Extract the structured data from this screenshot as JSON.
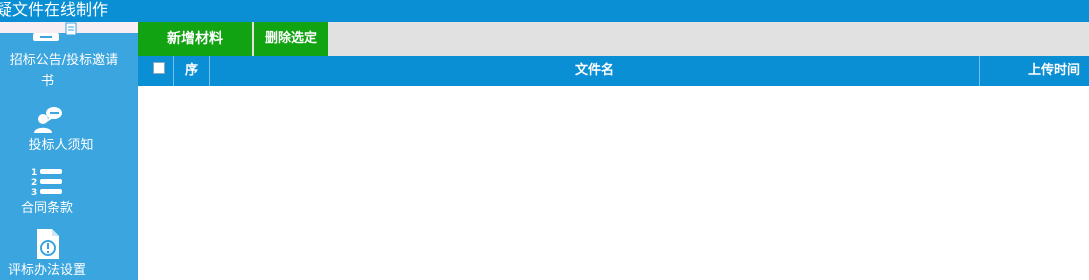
{
  "title": "疑文件在线制作",
  "sidebar": {
    "items": [
      {
        "label_line1": "招标公告/投标邀请",
        "label_line2": "书",
        "icon": "document-icon"
      },
      {
        "label": "投标人须知",
        "icon": "user-chat-icon"
      },
      {
        "label": "合同条款",
        "icon": "numbered-list-icon"
      },
      {
        "label": "评标办法设置",
        "icon": "warning-document-icon"
      }
    ]
  },
  "toolbar": {
    "add_label": "新增材料",
    "delete_label": "删除选定"
  },
  "table": {
    "columns": [
      "序",
      "文件名",
      "上传时间"
    ],
    "rows": []
  },
  "colors": {
    "primary_blue": "#0a8fd4",
    "sidebar_blue": "#3aa5df",
    "button_green": "#11a311",
    "toolbar_gray": "#e1e1e1"
  }
}
